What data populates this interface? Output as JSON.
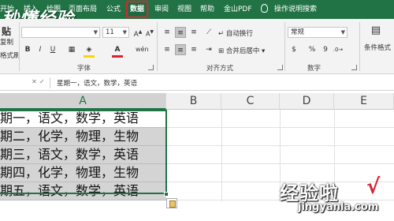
{
  "tabs": [
    {
      "label": "开始"
    },
    {
      "label": "插入"
    },
    {
      "label": "绘图"
    },
    {
      "label": "页面布局"
    },
    {
      "label": "公式"
    },
    {
      "label": "数据",
      "active": true
    },
    {
      "label": "审阅"
    },
    {
      "label": "视图"
    },
    {
      "label": "帮助"
    },
    {
      "label": "金山PDF"
    }
  ],
  "tell_me": "操作说明搜索",
  "ribbon": {
    "clipboard": {
      "paste_partial": "贴",
      "copy": "复制",
      "format_painter": "格式刷"
    },
    "font": {
      "size": "11",
      "group_label": "字体",
      "font_color": "#d9232e",
      "fill_color": "#ffd400"
    },
    "alignment": {
      "wrap_text": "自动换行",
      "merge_center": "合并后居中",
      "group_label": "对齐方式"
    },
    "number": {
      "format": "常规",
      "percent": "%",
      "comma": "9",
      "group_label": "数字"
    },
    "styles": {
      "conditional_format": "条件格式"
    }
  },
  "formula_bar": {
    "content": "星期一，语文，数学，英语"
  },
  "columns": [
    "A",
    "B",
    "C",
    "D",
    "E"
  ],
  "cells": [
    "期一，语文，数学，英语",
    "期二，化学，物理，生物",
    "期三，语文，数学，英语",
    "期四，化学，物理，生物",
    "期五，语文，数学，英语"
  ],
  "watermark": {
    "top_left": "秒懂经验",
    "bottom_right": "经验啦",
    "check": "√",
    "url": "jingyanla.com"
  },
  "colors": {
    "brand": "#217346",
    "highlight": "#d9232e"
  }
}
